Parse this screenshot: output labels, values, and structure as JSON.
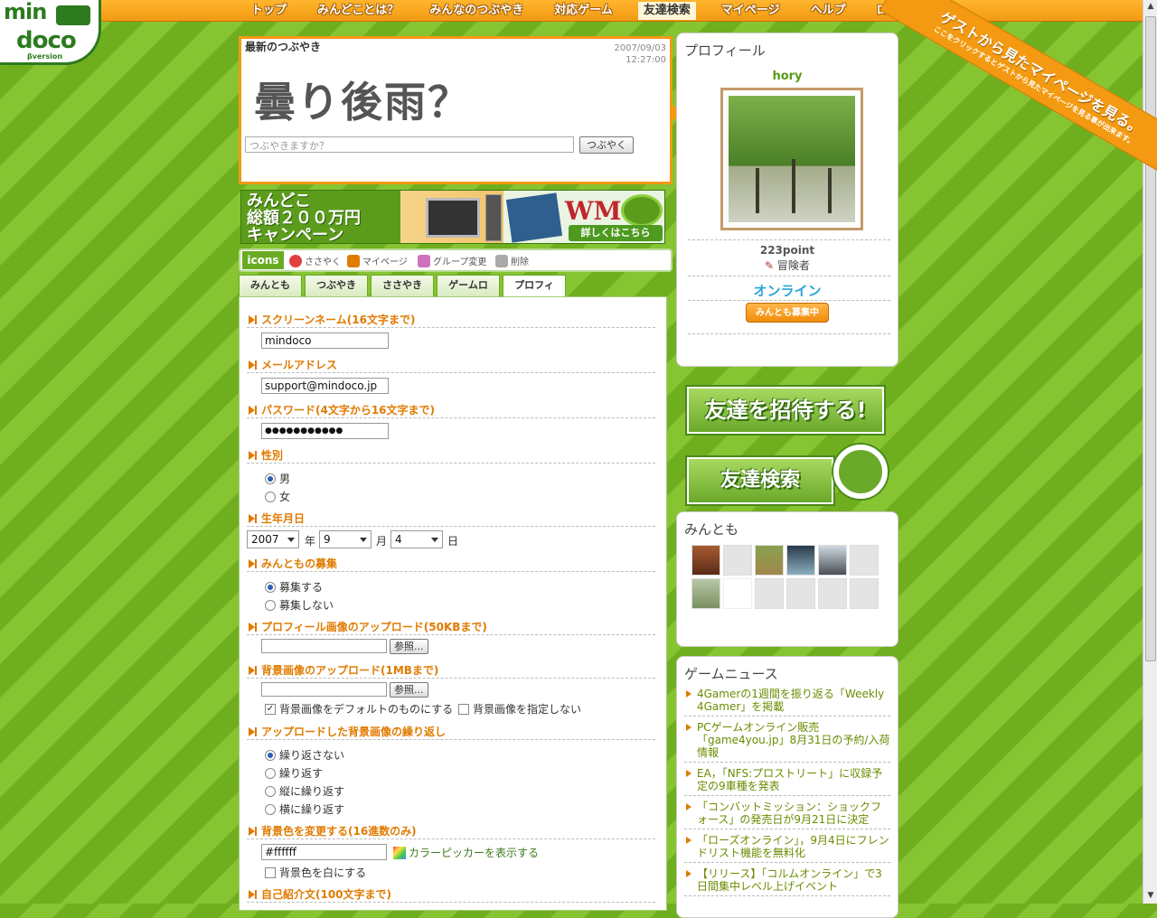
{
  "nav": {
    "items": [
      "トップ",
      "みんどことは？",
      "みんなのつぶやき",
      "対応ゲーム",
      "友達検索",
      "マイページ",
      "ヘルプ",
      "ログアウト"
    ],
    "active_index": 4
  },
  "logo": {
    "text1": "min",
    "text2": "doco",
    "sub": "βversion"
  },
  "ribbon": {
    "big": "ゲストから見たマイページを見る。",
    "small": "ここをクリックするとゲストから見たマイページを見る事が出来ます。"
  },
  "tweet": {
    "heading": "最新のつぶやき",
    "date": "2007/09/03",
    "time": "12:27:00",
    "message": "曇り後雨？",
    "input_placeholder": "つぶやきますか？",
    "button": "つぶやく"
  },
  "banner": {
    "line1": "みんどこ",
    "line2": "総額２００万円",
    "line3": "キャンペーン",
    "more": "詳しくはこちら"
  },
  "icons_bar": {
    "label": "icons",
    "items": [
      "ささやく",
      "マイページ",
      "グループ変更",
      "削除"
    ]
  },
  "tabs": [
    "みんとも",
    "つぶやきログ",
    "ささやきログ",
    "ゲームログ",
    "プロフィール"
  ],
  "form": {
    "screen_name": {
      "label": "スクリーンネーム(16文字まで)",
      "value": "mindoco"
    },
    "email": {
      "label": "メールアドレス",
      "value": "support@mindoco.jp"
    },
    "password": {
      "label": "パスワード(4文字から16文字まで)",
      "value": "●●●●●●●●●●●"
    },
    "gender": {
      "label": "性別",
      "options": [
        "男",
        "女"
      ],
      "selected": "男"
    },
    "birthday": {
      "label": "生年月日",
      "year": "2007",
      "year_unit": "年",
      "month": "9",
      "month_unit": "月",
      "day": "4",
      "day_unit": "日"
    },
    "recruit": {
      "label": "みんともの募集",
      "options": [
        "募集する",
        "募集しない"
      ],
      "selected": "募集する"
    },
    "profile_image": {
      "label": "プロフィール画像のアップロード(50KBまで)",
      "browse": "参照..."
    },
    "bg_image": {
      "label": "背景画像のアップロード(1MBまで)",
      "browse": "参照...",
      "check_default": "背景画像をデフォルトのものにする",
      "check_none": "背景画像を指定しない"
    },
    "bg_repeat": {
      "label": "アップロードした背景画像の繰り返し",
      "options": [
        "繰り返さない",
        "繰り返す",
        "縦に繰り返す",
        "横に繰り返す"
      ],
      "selected": "繰り返さない"
    },
    "bg_color": {
      "label": "背景色を変更する(16進数のみ)",
      "value": "#ffffff",
      "picker": "カラーピッカーを表示する",
      "check_white": "背景色を白にする"
    },
    "intro": {
      "label": "自己紹介文(100文字まで)"
    }
  },
  "profile": {
    "title": "プロフィール",
    "name": "hory",
    "points": "223point",
    "rank": "冒険者",
    "status": "オンライン",
    "recruit_badge": "みんとも募集中"
  },
  "buttons": {
    "invite": "友達を招待する!",
    "search": "友達検索"
  },
  "friends": {
    "title": "みんとも"
  },
  "news": {
    "title": "ゲームニュース",
    "items": [
      "4Gamerの1週間を振り返る「Weekly 4Gamer」を掲載",
      "PCゲームオンライン販売「game4you.jp」8月31日の予約/入荷情報",
      "EA，「NFS:プロストリート」に収録予定の9車種を発表",
      "「コンバットミッション：ショックフォース」の発売日が9月21日に決定",
      "「ローズオンライン」，9月4日にフレンドリスト機能を無料化",
      "【リリース】「コルムオンライン」で3日間集中レベル上げイベント"
    ]
  },
  "colors": {
    "accent": "#f39a12",
    "green": "#6aab24",
    "label_orange": "#e07b00",
    "online": "#29a5d8"
  }
}
